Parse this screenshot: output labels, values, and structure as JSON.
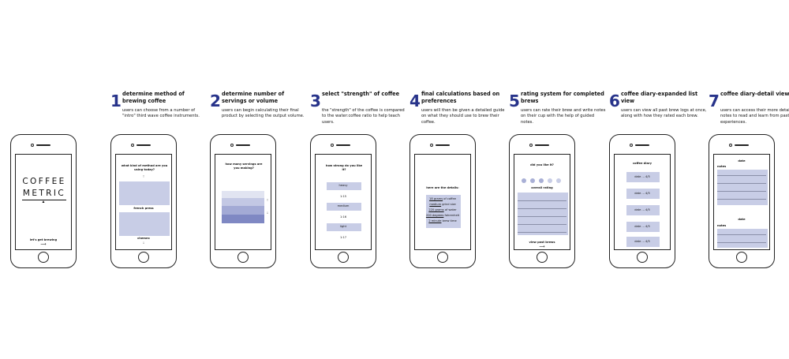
{
  "steps": [
    {
      "num": "1",
      "title": "determine method of brewing coffee",
      "desc": "users can choose from a number of \"intro\" third wave coffee instruments."
    },
    {
      "num": "2",
      "title": "determine number of servings or volume",
      "desc": "users can begin calculating their final product by selecting the output volume."
    },
    {
      "num": "3",
      "title": "select \"strength\" of coffee",
      "desc": "the \"strength\" of the coffee is compared to the water:coffee ratio to help teach users."
    },
    {
      "num": "4",
      "title": "final calculations based on preferences",
      "desc": "users will then be given a detailed guide on what they should use to brew their coffee."
    },
    {
      "num": "5",
      "title": "rating system for completed brews",
      "desc": "users can rate their brew and write notes on their cup with the help of guided notes."
    },
    {
      "num": "6",
      "title": "coffee diary-expanded list view",
      "desc": "users can view all past brew logs at once, along with how they rated each brew."
    },
    {
      "num": "7",
      "title": "coffee diary-detail view",
      "desc": "users can access their more detailed notes to read and learn from past experiences."
    }
  ],
  "screens": {
    "s0": {
      "logo_line1": "COFFEE",
      "logo_line2": "METRIC",
      "cta": "let's get brewing"
    },
    "s1": {
      "question": "what kind of method are you using today?",
      "option1": "french press",
      "option2": "chemex"
    },
    "s2": {
      "question": "how many servings are you making?"
    },
    "s3": {
      "question": "how strong do you like it?",
      "opt1": "heavy",
      "ratio1": "1:15",
      "opt2": "medium",
      "ratio2": "1:16",
      "opt3": "light",
      "ratio3": "1:17"
    },
    "s4": {
      "heading": "here are the details:",
      "lines": [
        {
          "u": "18 grams",
          "rest": " of coffee"
        },
        {
          "u": "medium",
          "rest": " grind size"
        },
        {
          "u": "220 grams",
          "rest": " of water"
        },
        {
          "u": "200 degrees",
          "rest": " fahrenheit"
        },
        {
          "u": "2 minute",
          "rest": " brew time"
        }
      ]
    },
    "s5": {
      "question": "did you like it?",
      "rating_label": "overall rating",
      "link": "view past brews"
    },
    "s6": {
      "title": "coffee diary",
      "entries": [
        "date ... 4/5",
        "date ... 4/5",
        "date ... 4/5",
        "date ... 4/5",
        "date ... 4/5"
      ]
    },
    "s7": {
      "date1": "date",
      "notes1": "notes",
      "date2": "date",
      "notes2": "notes"
    }
  },
  "colors": {
    "accent_number": "#27338a",
    "block_fill": "#c8cde6",
    "block_dark": "#6f79ba"
  }
}
